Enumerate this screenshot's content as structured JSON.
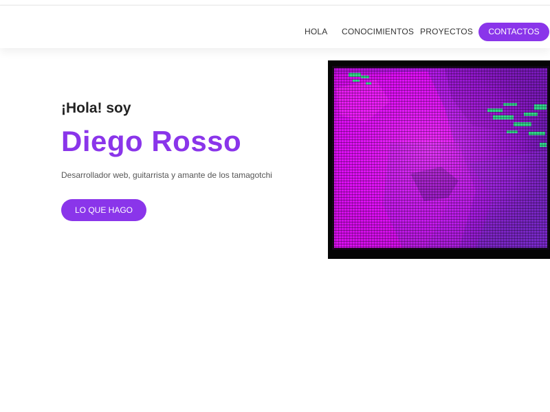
{
  "nav": {
    "items": [
      {
        "label": "HOLA"
      },
      {
        "label": "CONOCIMIENTOS"
      },
      {
        "label": "PROYECTOS"
      }
    ],
    "contact_label": "CONTACTOS"
  },
  "hero": {
    "kicker": "¡Hola! soy",
    "name": "Diego Rosso",
    "description": "Desarrollador web, guitarrista y amante de los tamagotchi",
    "cta_label": "LO QUE HAGO"
  },
  "colors": {
    "accent": "#8a35ea",
    "image_magenta": "#d80ef2",
    "image_green": "#2fe08a"
  },
  "image": {
    "semantic": "pixelated-crt-portrait"
  }
}
